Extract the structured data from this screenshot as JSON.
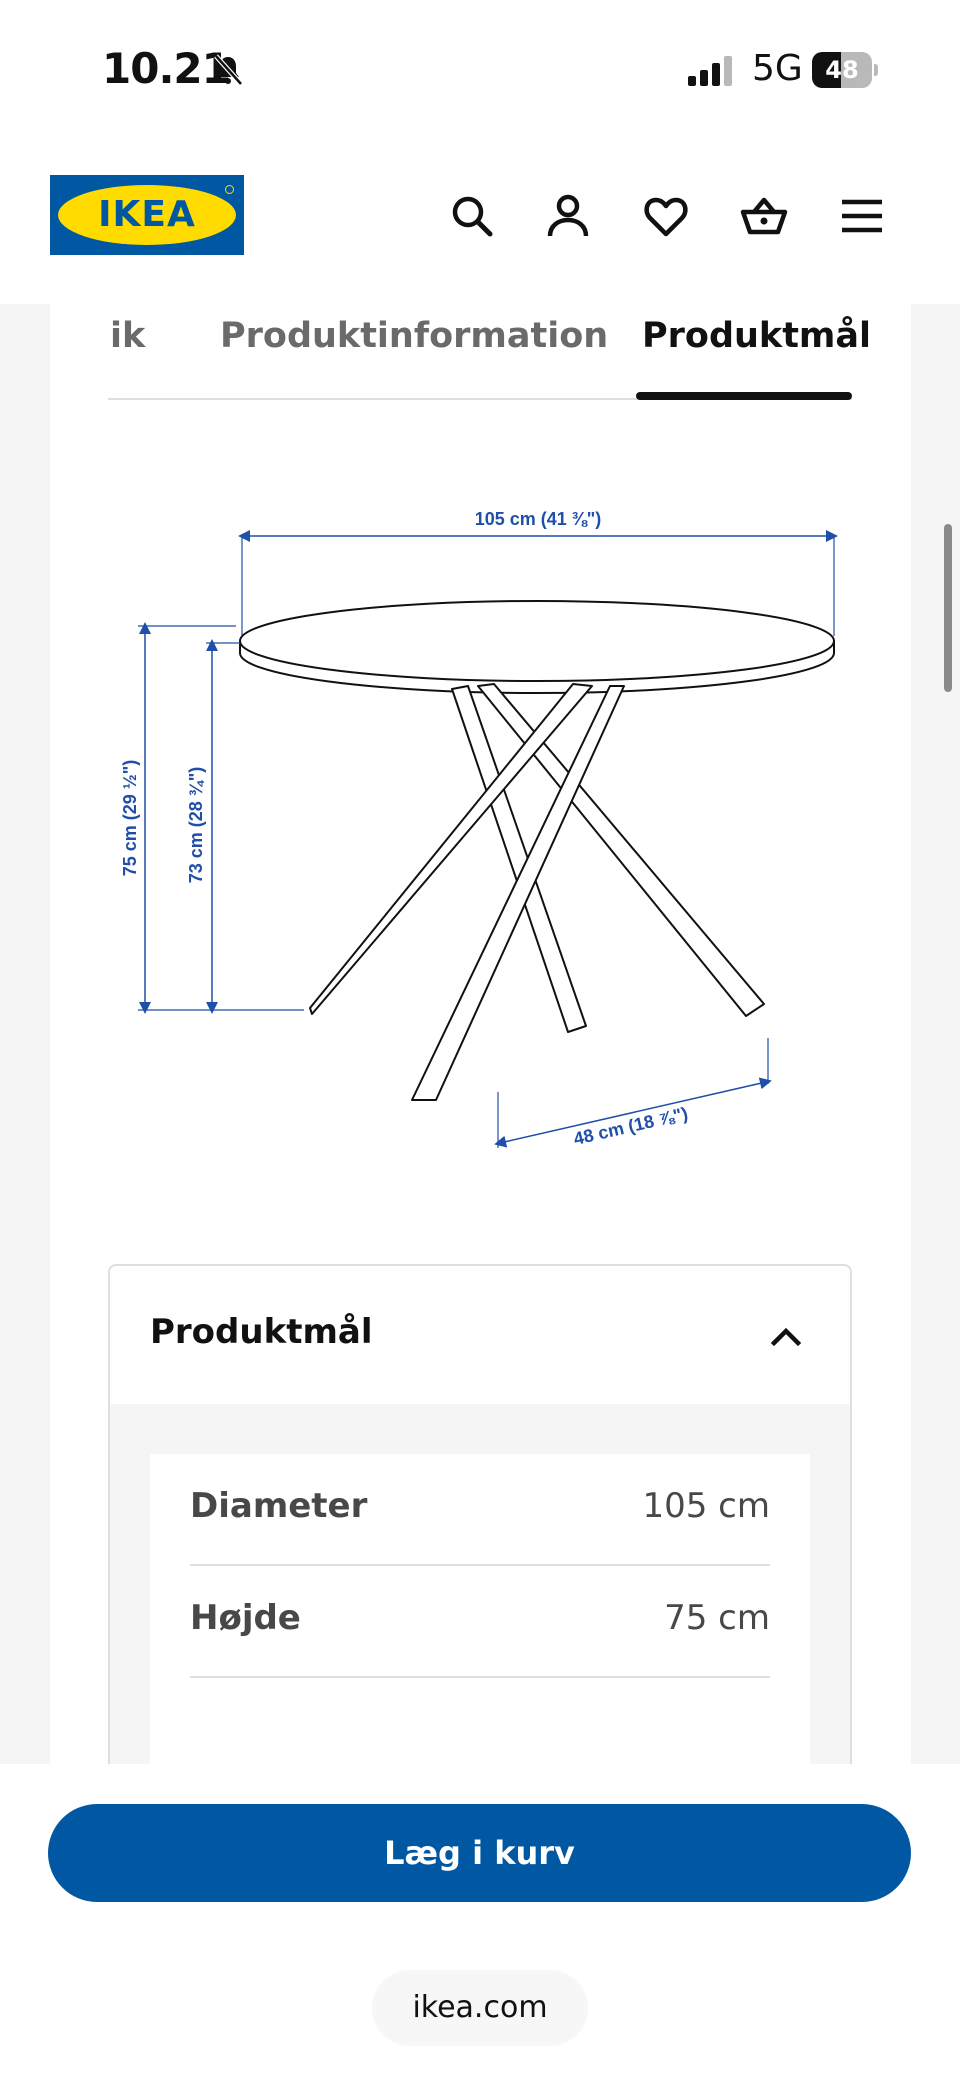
{
  "status_bar": {
    "time": "10.21",
    "network": "5G",
    "battery_level": "48",
    "battery_fraction": 0.48,
    "icons": [
      "bell-muted-icon",
      "signal-icon"
    ]
  },
  "header": {
    "logo_text": "IKEA",
    "icons": [
      "search-icon",
      "account-icon",
      "heart-icon",
      "cart-icon",
      "menu-icon"
    ]
  },
  "tabs": [
    {
      "label": "ik",
      "active": false
    },
    {
      "label": "Produktinformation",
      "active": false
    },
    {
      "label": "Produktmål",
      "active": true
    }
  ],
  "drawing": {
    "width_label": "105 cm (41 ⅜\")",
    "height_label": "75 cm (29 ½\")",
    "height_under_label": "73 cm (28 ¾\")",
    "leg_span_label": "48 cm (18 ⅞\")"
  },
  "accordion": {
    "title": "Produktmål",
    "rows": [
      {
        "label": "Diameter",
        "value": "105 cm"
      },
      {
        "label": "Højde",
        "value": "75 cm"
      }
    ]
  },
  "bottom": {
    "cart_button": "Læg i kurv",
    "url": "ikea.com"
  },
  "colors": {
    "brand_blue": "#0058a3",
    "brand_yellow": "#ffdb00",
    "dimension_blue": "#1f4fa8"
  }
}
